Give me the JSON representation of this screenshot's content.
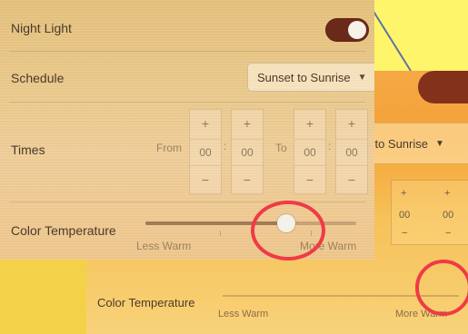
{
  "front": {
    "night_light_label": "Night Light",
    "schedule_label": "Schedule",
    "schedule_value": "Sunset to Sunrise",
    "times_label": "Times",
    "from_label": "From",
    "to_label": "To",
    "from_hours": "00",
    "from_minutes": "00",
    "to_hours": "00",
    "to_minutes": "00",
    "color_temp_label": "Color Temperature",
    "less_warm_label": "Less Warm",
    "more_warm_label": "More Warm",
    "night_light_on": true,
    "color_temperature_value": 0.67
  },
  "back": {
    "schedule_value": "et to Sunrise",
    "from_hours": "00",
    "from_minutes": "00",
    "color_temp_label": "Color Temperature",
    "less_warm_label": "Less Warm",
    "more_warm_label": "More Warm"
  },
  "colors": {
    "accent_toggle": "#6a2a1a",
    "annotation_red": "#ef3b46",
    "note_yellow": "#fff56a"
  },
  "icons": {
    "dropdown": "chevron-down-icon",
    "plus": "plus-icon",
    "minus": "minus-icon"
  }
}
